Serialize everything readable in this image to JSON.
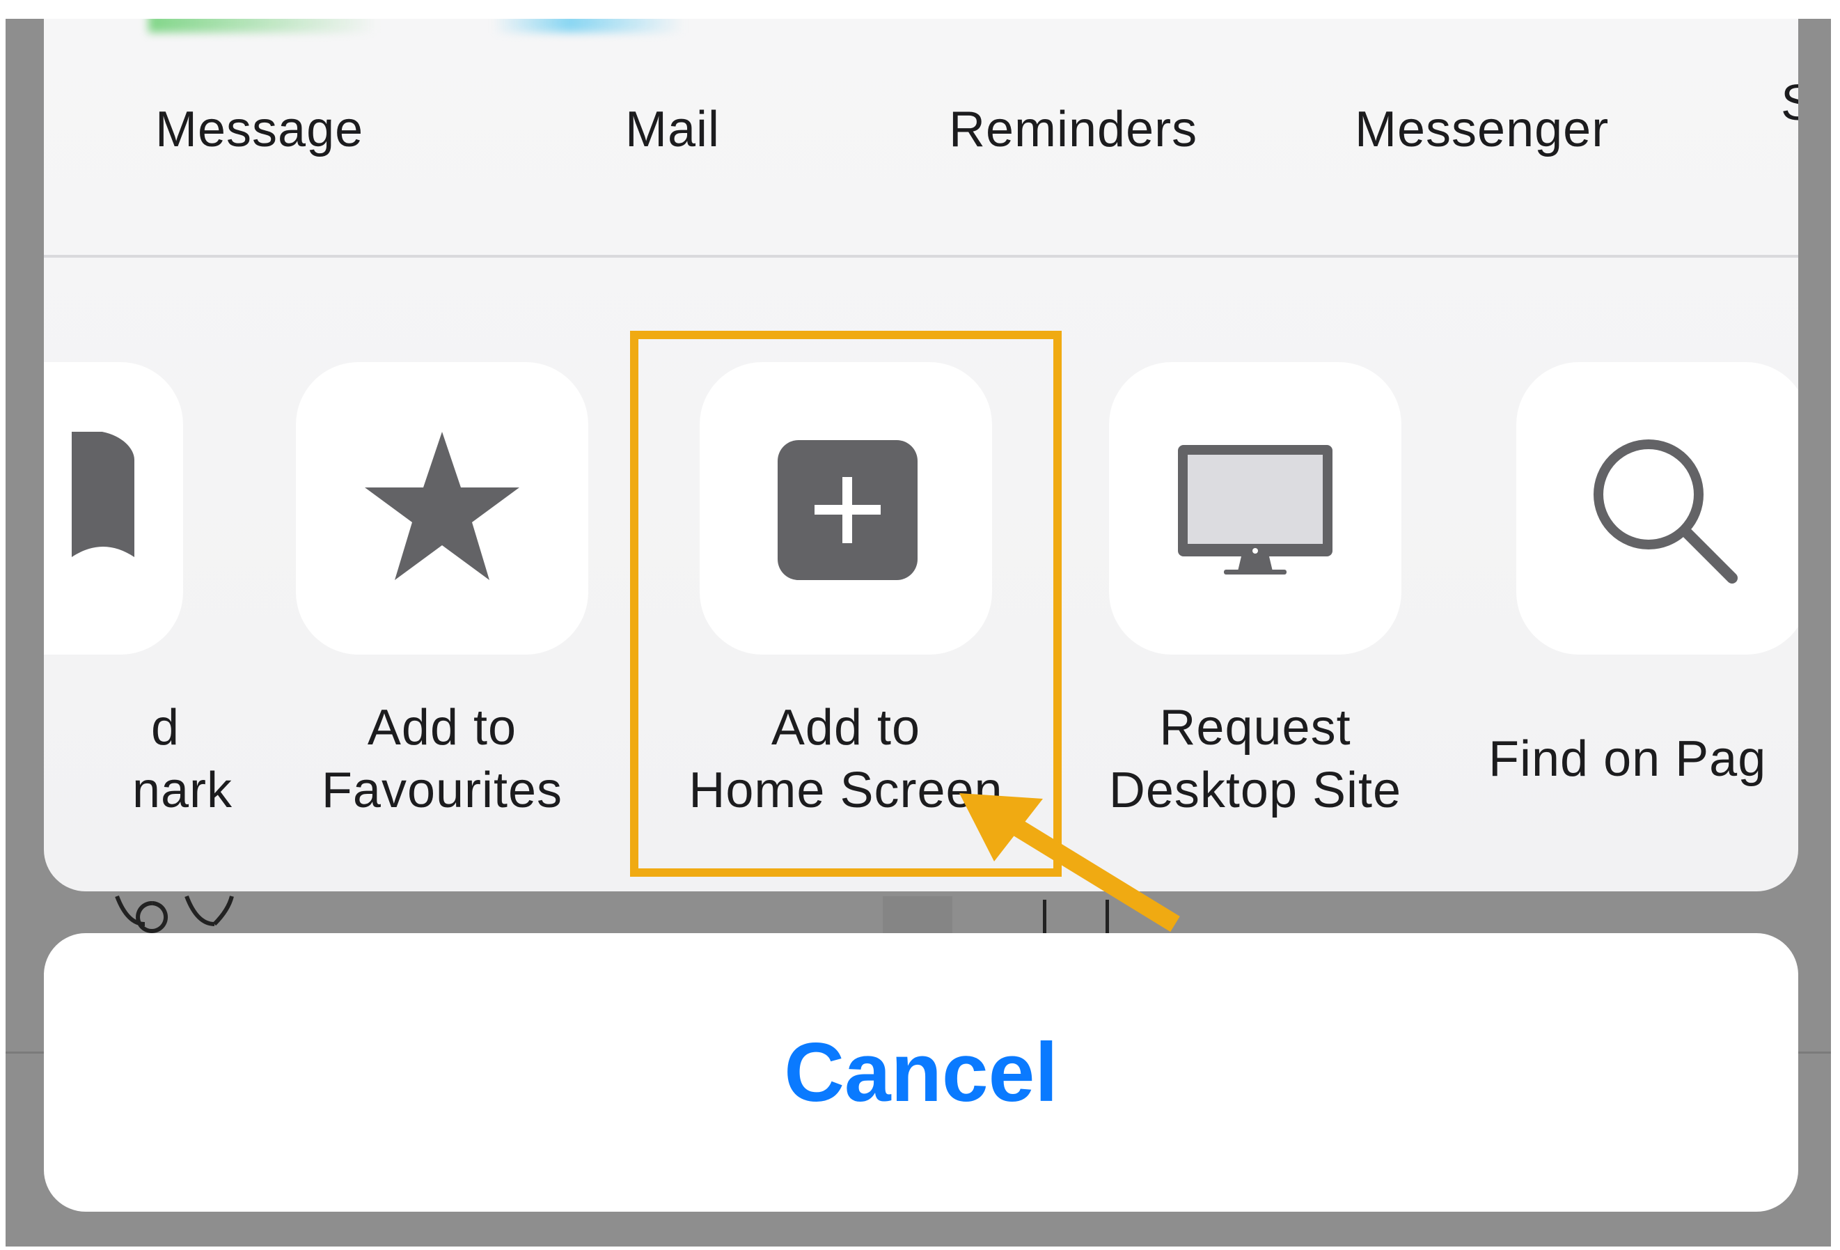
{
  "share_targets": [
    "Message",
    "Mail",
    "Reminders",
    "Messenger",
    "S"
  ],
  "actions": {
    "bookmark": {
      "label_line1": "d",
      "label_line2": "nark",
      "icon": "bookmark-icon"
    },
    "favourites": {
      "label_line1": "Add to",
      "label_line2": "Favourites",
      "icon": "star-icon"
    },
    "home_screen": {
      "label_line1": "Add to",
      "label_line2": "Home Screen",
      "icon": "plus-square-icon"
    },
    "desktop_site": {
      "label_line1": "Request",
      "label_line2": "Desktop Site",
      "icon": "desktop-icon"
    },
    "find": {
      "label_line1": "Find on Pag",
      "icon": "magnifier-icon"
    }
  },
  "cancel_label": "Cancel",
  "colors": {
    "accent": "#0a7aff",
    "highlight": "#f0aa12",
    "icon": "#636366"
  }
}
